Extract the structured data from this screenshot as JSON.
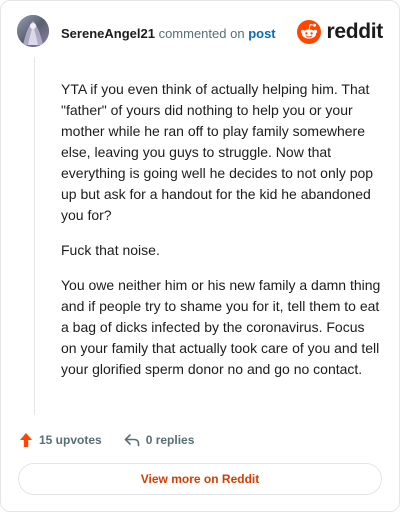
{
  "header": {
    "username": "SereneAngel21",
    "commented_on": "commented on",
    "post_link": "post",
    "brand": "reddit"
  },
  "comment": {
    "paragraphs": [
      "YTA if you even think of actually helping him. That \"father\" of yours did nothing to help you or your mother while he ran off to play family somewhere else, leaving you guys to struggle. Now that everything is going well he decides to not only pop up but ask for a handout for the kid he abandoned you for?",
      "Fuck that noise.",
      "You owe neither him or his new family a damn thing and if people try to shame you for it, tell them to eat a bag of dicks infected by the coronavirus. Focus on your family that actually took care of you and tell your glorified sperm donor no and go no contact."
    ]
  },
  "actions": {
    "upvotes": "15 upvotes",
    "replies": "0 replies"
  },
  "footer": {
    "view_more": "View more on Reddit"
  },
  "colors": {
    "brand_orange": "#ff4500",
    "link_blue": "#0a6bb5",
    "cta_text": "#d93a00"
  }
}
